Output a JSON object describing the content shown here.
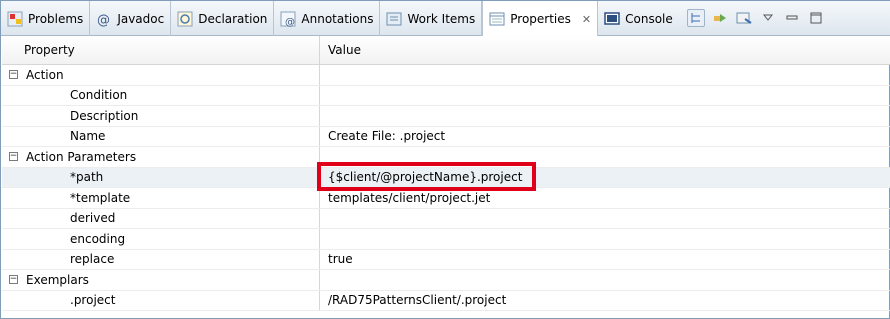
{
  "tabs": [
    {
      "label": "Problems",
      "icon": "problems-icon"
    },
    {
      "label": "Javadoc",
      "icon": "javadoc-icon"
    },
    {
      "label": "Declaration",
      "icon": "declaration-icon"
    },
    {
      "label": "Annotations",
      "icon": "annotations-icon"
    },
    {
      "label": "Work Items",
      "icon": "work-items-icon"
    },
    {
      "label": "Properties",
      "icon": "properties-icon",
      "active": true
    },
    {
      "label": "Console",
      "icon": "console-icon"
    }
  ],
  "table": {
    "headers": {
      "property": "Property",
      "value": "Value"
    },
    "rows": [
      {
        "property": "Action",
        "value": "",
        "group": true
      },
      {
        "property": "Condition",
        "value": ""
      },
      {
        "property": "Description",
        "value": ""
      },
      {
        "property": "Name",
        "value": "Create File: .project"
      },
      {
        "property": "Action Parameters",
        "value": "",
        "group": true
      },
      {
        "property": "*path",
        "value": "{$client/@projectName}.project",
        "selected": true
      },
      {
        "property": "*template",
        "value": "templates/client/project.jet"
      },
      {
        "property": "derived",
        "value": ""
      },
      {
        "property": "encoding",
        "value": ""
      },
      {
        "property": "replace",
        "value": "true"
      },
      {
        "property": "Exemplars",
        "value": "",
        "group": true
      },
      {
        "property": ".project",
        "value": "/RAD75PatternsClient/.project"
      }
    ]
  },
  "colors": {
    "highlight": "#e0001a",
    "selected_row": "#ecf1f6"
  }
}
